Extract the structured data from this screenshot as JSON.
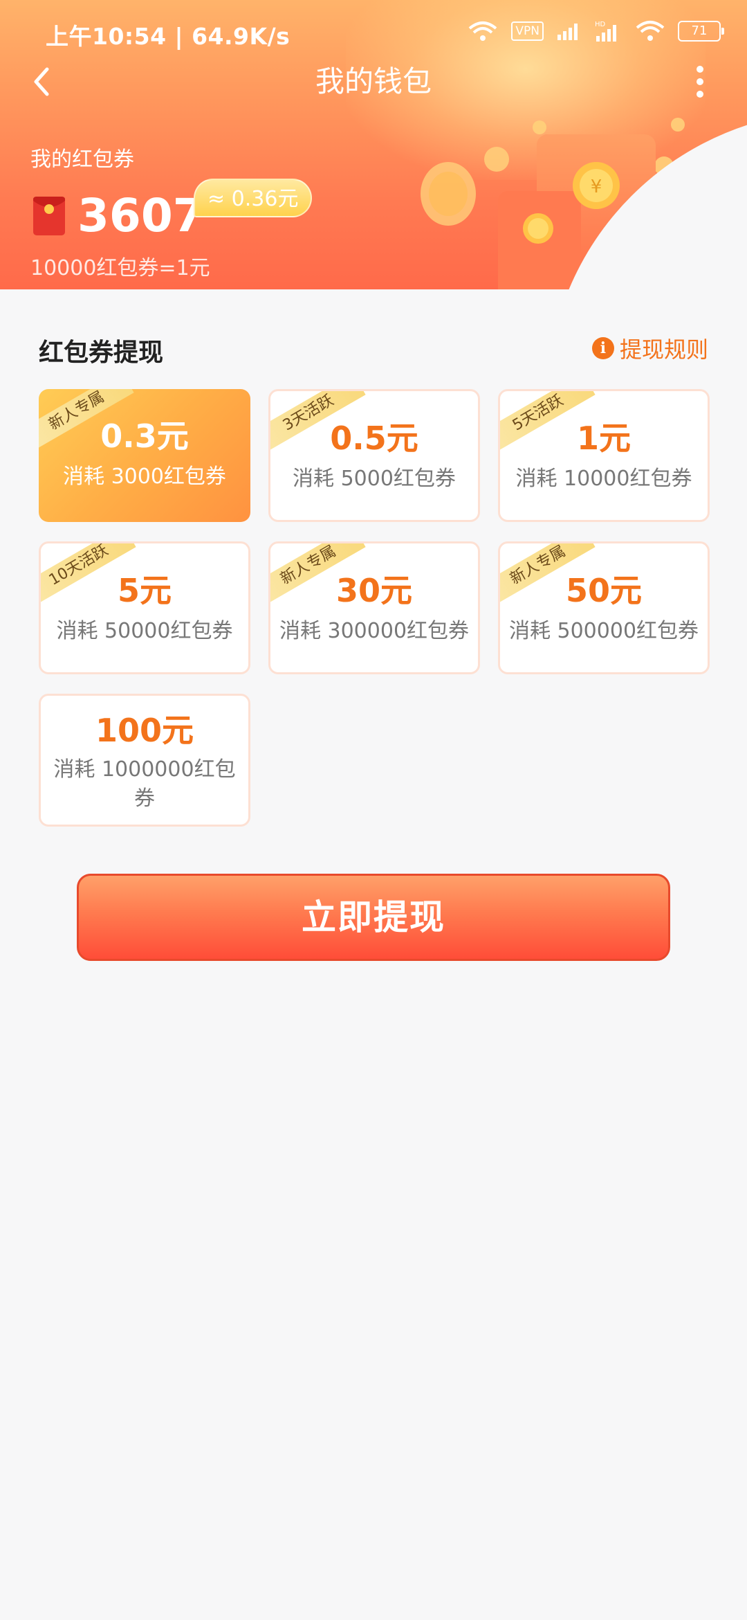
{
  "status_bar": {
    "time": "上午10:54 | 64.9K/s",
    "vpn": "VPN",
    "hd": "HD",
    "battery": "71"
  },
  "nav": {
    "title": "我的钱包"
  },
  "wallet": {
    "label": "我的红包券",
    "balance": "3607",
    "approx": "≈ 0.36元",
    "rate": "10000红包券=1元"
  },
  "section": {
    "title": "红包券提现",
    "rules": "提现规则"
  },
  "options": [
    {
      "tag": "新人专属",
      "amount": "0.3元",
      "cost": "消耗 3000红包券",
      "selected": true
    },
    {
      "tag": "3天活跃",
      "amount": "0.5元",
      "cost": "消耗 5000红包券",
      "selected": false
    },
    {
      "tag": "5天活跃",
      "amount": "1元",
      "cost": "消耗 10000红包券",
      "selected": false
    },
    {
      "tag": "10天活跃",
      "amount": "5元",
      "cost": "消耗 50000红包券",
      "selected": false
    },
    {
      "tag": "新人专属",
      "amount": "30元",
      "cost": "消耗 300000红包券",
      "selected": false
    },
    {
      "tag": "新人专属",
      "amount": "50元",
      "cost": "消耗 500000红包券",
      "selected": false
    },
    {
      "tag": "",
      "amount": "100元",
      "cost": "消耗 1000000红包券",
      "selected": false
    }
  ],
  "button": {
    "label": "立即提现"
  },
  "colors": {
    "accent": "#f3731b",
    "button": "#ff5a3c",
    "card_border": "#fde0d3"
  },
  "icons": {
    "back": "back-arrow-icon",
    "more": "more-vertical-icon",
    "info": "info-icon",
    "red_packet": "red-packet-icon"
  }
}
